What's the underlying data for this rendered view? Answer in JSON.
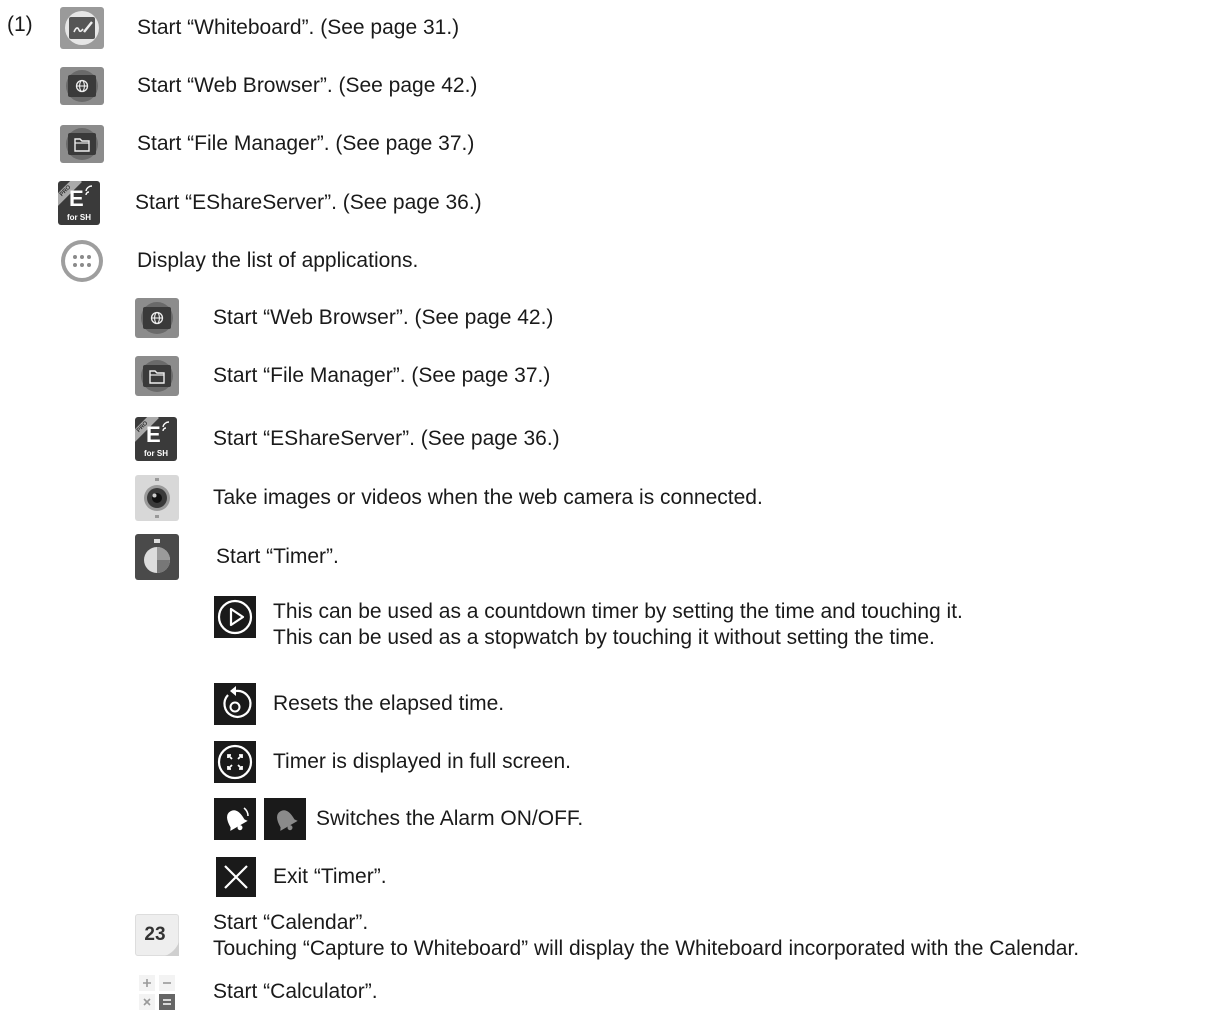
{
  "item_number": "(1)",
  "items": {
    "whiteboard": "Start “Whiteboard”. (See page 31.)",
    "web_browser": "Start “Web Browser”. (See page 42.)",
    "file_manager": "Start “File Manager”. (See page 37.)",
    "eshare": "Start “EShareServer”. (See page 36.)",
    "app_list": "Display the list of applications."
  },
  "apps": {
    "web_browser": "Start “Web Browser”. (See page 42.)",
    "file_manager": "Start “File Manager”. (See page 37.)",
    "eshare": "Start “EShareServer”. (See page 36.)",
    "camera": "Take images or videos when the web camera is connected.",
    "timer": "Start “Timer”.",
    "calendar_line1": "Start “Calendar”.",
    "calendar_line2": "Touching “Capture to Whiteboard” will display the Whiteboard incorporated with the Calendar.",
    "calculator": "Start “Calculator”."
  },
  "timer": {
    "start_line1": "This can be used as a countdown timer by setting the time and touching it.",
    "start_line2": "This can be used as a stopwatch by touching it without setting the time.",
    "reset": "Resets the elapsed time.",
    "fullscreen": "Timer is displayed in full screen.",
    "alarm": "Switches the Alarm ON/OFF.",
    "exit": "Exit “Timer”."
  },
  "icon_labels": {
    "eshare_pro": "PRO",
    "eshare_letter": "E",
    "eshare_for": "for SH",
    "calendar_day": "23"
  }
}
